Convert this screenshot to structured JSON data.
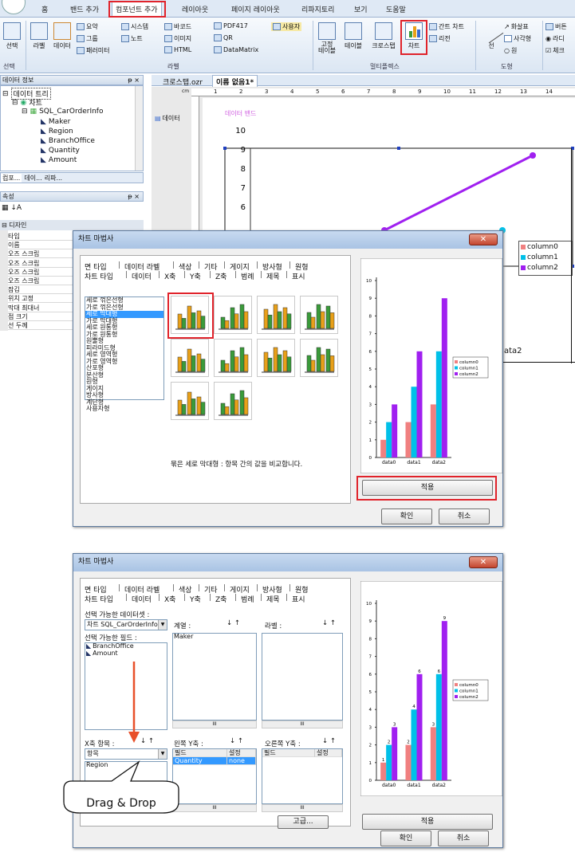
{
  "ribbon": {
    "tabs": [
      "홈",
      "밴드 추가",
      "컴포넌트 추가",
      "레이아웃",
      "페이지 레이아웃",
      "리파지토리",
      "보기",
      "도움말"
    ],
    "items": {
      "select": "선택",
      "label": "라벨",
      "data": "데이터",
      "summary": "요약",
      "group": "그룹",
      "parameter": "패러미터",
      "system": "시스템",
      "note": "노트",
      "image": "이미지",
      "html": "HTML",
      "barcode": "바코드",
      "pdf417": "PDF417",
      "qr": "QR",
      "datamatrix": "DataMatrix",
      "user": "사용자",
      "fixed_table": "고정\n테이블",
      "table": "테이블",
      "crosstab": "크로스탭",
      "chart": "차트",
      "gantt": "간트 차트",
      "legend": "리전",
      "line": "선",
      "arrow": "화살표",
      "rect": "사각형",
      "circle": "원",
      "button": "버튼",
      "radio": "라디",
      "check": "체크"
    },
    "groups": [
      "선택",
      "라벨",
      "멀티플렉스",
      "도형"
    ]
  },
  "left": {
    "data_info_title": "데이터 정보",
    "tree": [
      "데이터 트리",
      "차트",
      "SQL_CarOrderInfo",
      "Maker",
      "Region",
      "BranchOffice",
      "Quantity",
      "Amount"
    ],
    "bottom_tabs": [
      "컴포...",
      "데이...",
      "리파..."
    ],
    "props_title": "속성",
    "design_title": "디자인",
    "props": [
      "타입",
      "이름",
      "오즈 스크립",
      "오즈 스크립",
      "오즈 스크립",
      "오즈 스크립",
      "잠김",
      "위치 고정",
      "막대 최대너",
      "점 크기",
      "선 두께"
    ]
  },
  "doc": {
    "tabs": [
      "크로스탭.ozr",
      "이름 없음1*"
    ],
    "ruler_unit": "cm",
    "ruler_numbers": [
      "1",
      "2",
      "3",
      "4",
      "5",
      "6",
      "7",
      "8",
      "9",
      "10",
      "11",
      "12",
      "13",
      "14"
    ],
    "band_label": "데이터",
    "band_title": "데이터 밴드",
    "canvas_y_ticks": [
      "10",
      "9",
      "8",
      "7",
      "6"
    ],
    "legend": [
      "column0",
      "column1",
      "column2"
    ],
    "x_fragment": "ata2"
  },
  "colors": {
    "c0": "#f08080",
    "c1": "#00c0e8",
    "c2": "#a020f0",
    "accent_red": "#e0232b"
  },
  "dialog1": {
    "title": "차트 마법사",
    "tabs_row1": [
      "면 타입",
      "데이터 라벨",
      "색상",
      "기타",
      "게이지",
      "방사형",
      "원형"
    ],
    "tabs_row2": [
      "차트 타입",
      "데이터",
      "X축",
      "Y축",
      "Z축",
      "범례",
      "제목",
      "표시"
    ],
    "type_list": [
      "세로 꺾은선형",
      "가로 꺾은선형",
      "세로 막대형",
      "가로 막대형",
      "세로 원통형",
      "가로 원통형",
      "원뿔형",
      "피라미드형",
      "세로 영역형",
      "가로 영역형",
      "산포형",
      "분산형",
      "원형",
      "게이지",
      "방사형",
      "계단형",
      "사용자형"
    ],
    "selected_type": "세로 막대형",
    "description": "묶은 세로 막대형 : 항목 간의 값을 비교합니다.",
    "apply": "적용",
    "ok": "확인",
    "cancel": "취소"
  },
  "dialog2": {
    "title": "차트 마법사",
    "tabs_row1": [
      "면 타입",
      "데이터 라벨",
      "색상",
      "기타",
      "게이지",
      "방사형",
      "원형"
    ],
    "tabs_row2": [
      "차트 타입",
      "데이터",
      "X축",
      "Y축",
      "Z축",
      "범례",
      "제목",
      "표시"
    ],
    "dataset_label": "선택 가능한 데이터셋 :",
    "dataset_value": "차트 SQL_CarOrderInfo",
    "fields_label": "선택 가능한 필드 :",
    "fields": [
      "BranchOffice",
      "Amount"
    ],
    "series_label": "계열 :",
    "series_items": [
      "Maker"
    ],
    "label_label": "라벨 :",
    "xaxis_label": "X축 항목 :",
    "xaxis_value": "항목",
    "xaxis_items": [
      "Region"
    ],
    "lefty_label": "왼쪽 Y축 :",
    "righty_label": "오른쪽 Y축 :",
    "grid_headers": [
      "필드",
      "설정"
    ],
    "grid_row": [
      "Quantity",
      "none"
    ],
    "scroll_mid": "III",
    "advanced": "고급...",
    "apply": "적용",
    "ok": "확인",
    "cancel": "취소",
    "callout": "Drag & Drop"
  },
  "chart_data": [
    {
      "type": "bar",
      "categories": [
        "data0",
        "data1",
        "data2"
      ],
      "series": [
        {
          "name": "column0",
          "values": [
            1,
            2,
            3
          ]
        },
        {
          "name": "column1",
          "values": [
            2,
            4,
            6
          ]
        },
        {
          "name": "column2",
          "values": [
            3,
            6,
            9
          ]
        }
      ],
      "ylim": [
        0,
        10
      ],
      "y_ticks": [
        "0",
        "1",
        "2",
        "3",
        "4",
        "5",
        "6",
        "7",
        "8",
        "9",
        "10"
      ],
      "legend_position": "right",
      "data_labels": false
    },
    {
      "type": "bar",
      "categories": [
        "data0",
        "data1",
        "data2"
      ],
      "series": [
        {
          "name": "column0",
          "values": [
            1,
            2,
            3
          ]
        },
        {
          "name": "column1",
          "values": [
            2,
            4,
            6
          ]
        },
        {
          "name": "column2",
          "values": [
            3,
            6,
            9
          ]
        }
      ],
      "ylim": [
        0,
        10
      ],
      "y_ticks": [
        "0",
        "1",
        "2",
        "3",
        "4",
        "5",
        "6",
        "7",
        "8",
        "9",
        "10"
      ],
      "legend_position": "right",
      "data_labels": true
    }
  ]
}
